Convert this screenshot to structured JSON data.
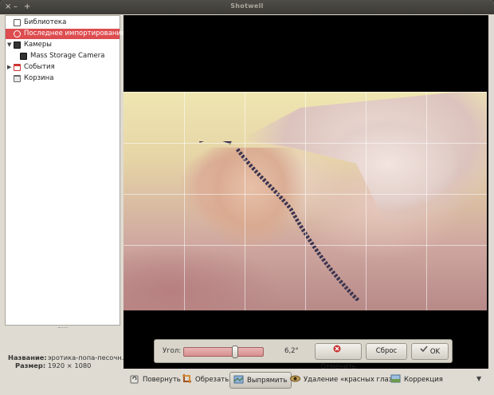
{
  "window": {
    "title": "Shotwell",
    "controls": [
      "×",
      "–",
      "+"
    ]
  },
  "sidebar": {
    "items": [
      {
        "label": "Библиотека",
        "icon": "library-icon",
        "indent": 0,
        "selected": false
      },
      {
        "label": "Последнее импортирование",
        "icon": "recent-import-icon",
        "indent": 0,
        "selected": true
      },
      {
        "label": "Камеры",
        "icon": "cameras-icon",
        "indent": 0,
        "expanded": true
      },
      {
        "label": "Mass Storage Camera",
        "icon": "camera-icon",
        "indent": 1
      },
      {
        "label": "События",
        "icon": "events-icon",
        "indent": 0,
        "expanded": false
      },
      {
        "label": "Корзина",
        "icon": "trash-icon",
        "indent": 0
      }
    ]
  },
  "properties": {
    "name_label": "Название:",
    "name_value": "эротика-попа-песочн...",
    "size_label": "Размер:",
    "size_value": "1920 × 1080"
  },
  "straighten": {
    "angle_label": "Угол:",
    "angle_value": "6,2°",
    "slider_fraction": 0.66,
    "cancel_label": "Отменить",
    "reset_label": "Сброс",
    "ok_label": "OK"
  },
  "toolbar": {
    "rotate_label": "Повернуть",
    "crop_label": "Обрезать",
    "straighten_label": "Выпрямить",
    "redeye_label": "Удаление «красных глаз»",
    "adjust_label": "Коррекция"
  },
  "colors": {
    "selection": "#dd4c4f",
    "titlebar": "#3f3e3a",
    "window_bg": "#dfdbd2"
  }
}
